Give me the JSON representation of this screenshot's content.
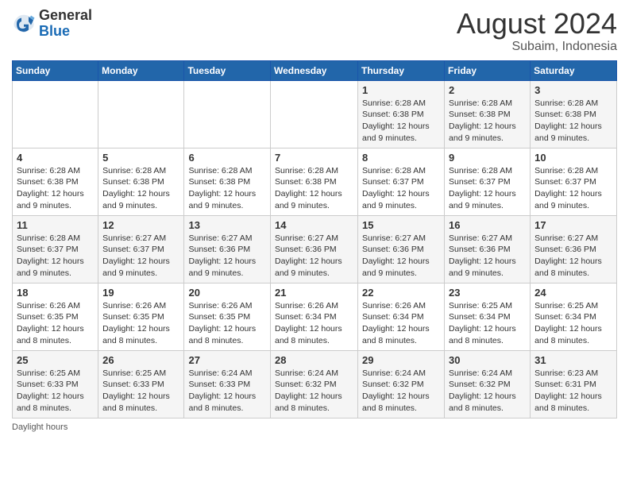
{
  "header": {
    "logo_general": "General",
    "logo_blue": "Blue",
    "month_year": "August 2024",
    "location": "Subaim, Indonesia"
  },
  "footer": {
    "label": "Daylight hours"
  },
  "weekdays": [
    "Sunday",
    "Monday",
    "Tuesday",
    "Wednesday",
    "Thursday",
    "Friday",
    "Saturday"
  ],
  "weeks": [
    [
      {
        "day": "",
        "sunrise": "",
        "sunset": "",
        "daylight": ""
      },
      {
        "day": "",
        "sunrise": "",
        "sunset": "",
        "daylight": ""
      },
      {
        "day": "",
        "sunrise": "",
        "sunset": "",
        "daylight": ""
      },
      {
        "day": "",
        "sunrise": "",
        "sunset": "",
        "daylight": ""
      },
      {
        "day": "1",
        "sunrise": "Sunrise: 6:28 AM",
        "sunset": "Sunset: 6:38 PM",
        "daylight": "Daylight: 12 hours and 9 minutes."
      },
      {
        "day": "2",
        "sunrise": "Sunrise: 6:28 AM",
        "sunset": "Sunset: 6:38 PM",
        "daylight": "Daylight: 12 hours and 9 minutes."
      },
      {
        "day": "3",
        "sunrise": "Sunrise: 6:28 AM",
        "sunset": "Sunset: 6:38 PM",
        "daylight": "Daylight: 12 hours and 9 minutes."
      }
    ],
    [
      {
        "day": "4",
        "sunrise": "Sunrise: 6:28 AM",
        "sunset": "Sunset: 6:38 PM",
        "daylight": "Daylight: 12 hours and 9 minutes."
      },
      {
        "day": "5",
        "sunrise": "Sunrise: 6:28 AM",
        "sunset": "Sunset: 6:38 PM",
        "daylight": "Daylight: 12 hours and 9 minutes."
      },
      {
        "day": "6",
        "sunrise": "Sunrise: 6:28 AM",
        "sunset": "Sunset: 6:38 PM",
        "daylight": "Daylight: 12 hours and 9 minutes."
      },
      {
        "day": "7",
        "sunrise": "Sunrise: 6:28 AM",
        "sunset": "Sunset: 6:38 PM",
        "daylight": "Daylight: 12 hours and 9 minutes."
      },
      {
        "day": "8",
        "sunrise": "Sunrise: 6:28 AM",
        "sunset": "Sunset: 6:37 PM",
        "daylight": "Daylight: 12 hours and 9 minutes."
      },
      {
        "day": "9",
        "sunrise": "Sunrise: 6:28 AM",
        "sunset": "Sunset: 6:37 PM",
        "daylight": "Daylight: 12 hours and 9 minutes."
      },
      {
        "day": "10",
        "sunrise": "Sunrise: 6:28 AM",
        "sunset": "Sunset: 6:37 PM",
        "daylight": "Daylight: 12 hours and 9 minutes."
      }
    ],
    [
      {
        "day": "11",
        "sunrise": "Sunrise: 6:28 AM",
        "sunset": "Sunset: 6:37 PM",
        "daylight": "Daylight: 12 hours and 9 minutes."
      },
      {
        "day": "12",
        "sunrise": "Sunrise: 6:27 AM",
        "sunset": "Sunset: 6:37 PM",
        "daylight": "Daylight: 12 hours and 9 minutes."
      },
      {
        "day": "13",
        "sunrise": "Sunrise: 6:27 AM",
        "sunset": "Sunset: 6:36 PM",
        "daylight": "Daylight: 12 hours and 9 minutes."
      },
      {
        "day": "14",
        "sunrise": "Sunrise: 6:27 AM",
        "sunset": "Sunset: 6:36 PM",
        "daylight": "Daylight: 12 hours and 9 minutes."
      },
      {
        "day": "15",
        "sunrise": "Sunrise: 6:27 AM",
        "sunset": "Sunset: 6:36 PM",
        "daylight": "Daylight: 12 hours and 9 minutes."
      },
      {
        "day": "16",
        "sunrise": "Sunrise: 6:27 AM",
        "sunset": "Sunset: 6:36 PM",
        "daylight": "Daylight: 12 hours and 9 minutes."
      },
      {
        "day": "17",
        "sunrise": "Sunrise: 6:27 AM",
        "sunset": "Sunset: 6:36 PM",
        "daylight": "Daylight: 12 hours and 8 minutes."
      }
    ],
    [
      {
        "day": "18",
        "sunrise": "Sunrise: 6:26 AM",
        "sunset": "Sunset: 6:35 PM",
        "daylight": "Daylight: 12 hours and 8 minutes."
      },
      {
        "day": "19",
        "sunrise": "Sunrise: 6:26 AM",
        "sunset": "Sunset: 6:35 PM",
        "daylight": "Daylight: 12 hours and 8 minutes."
      },
      {
        "day": "20",
        "sunrise": "Sunrise: 6:26 AM",
        "sunset": "Sunset: 6:35 PM",
        "daylight": "Daylight: 12 hours and 8 minutes."
      },
      {
        "day": "21",
        "sunrise": "Sunrise: 6:26 AM",
        "sunset": "Sunset: 6:34 PM",
        "daylight": "Daylight: 12 hours and 8 minutes."
      },
      {
        "day": "22",
        "sunrise": "Sunrise: 6:26 AM",
        "sunset": "Sunset: 6:34 PM",
        "daylight": "Daylight: 12 hours and 8 minutes."
      },
      {
        "day": "23",
        "sunrise": "Sunrise: 6:25 AM",
        "sunset": "Sunset: 6:34 PM",
        "daylight": "Daylight: 12 hours and 8 minutes."
      },
      {
        "day": "24",
        "sunrise": "Sunrise: 6:25 AM",
        "sunset": "Sunset: 6:34 PM",
        "daylight": "Daylight: 12 hours and 8 minutes."
      }
    ],
    [
      {
        "day": "25",
        "sunrise": "Sunrise: 6:25 AM",
        "sunset": "Sunset: 6:33 PM",
        "daylight": "Daylight: 12 hours and 8 minutes."
      },
      {
        "day": "26",
        "sunrise": "Sunrise: 6:25 AM",
        "sunset": "Sunset: 6:33 PM",
        "daylight": "Daylight: 12 hours and 8 minutes."
      },
      {
        "day": "27",
        "sunrise": "Sunrise: 6:24 AM",
        "sunset": "Sunset: 6:33 PM",
        "daylight": "Daylight: 12 hours and 8 minutes."
      },
      {
        "day": "28",
        "sunrise": "Sunrise: 6:24 AM",
        "sunset": "Sunset: 6:32 PM",
        "daylight": "Daylight: 12 hours and 8 minutes."
      },
      {
        "day": "29",
        "sunrise": "Sunrise: 6:24 AM",
        "sunset": "Sunset: 6:32 PM",
        "daylight": "Daylight: 12 hours and 8 minutes."
      },
      {
        "day": "30",
        "sunrise": "Sunrise: 6:24 AM",
        "sunset": "Sunset: 6:32 PM",
        "daylight": "Daylight: 12 hours and 8 minutes."
      },
      {
        "day": "31",
        "sunrise": "Sunrise: 6:23 AM",
        "sunset": "Sunset: 6:31 PM",
        "daylight": "Daylight: 12 hours and 8 minutes."
      }
    ]
  ]
}
